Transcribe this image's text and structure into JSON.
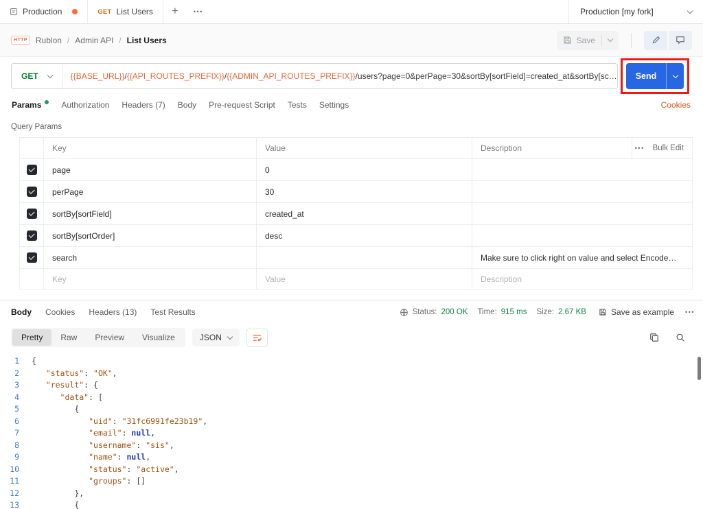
{
  "colors": {
    "brand_orange": "#ff6c37",
    "method_get_green": "#007f31",
    "send_button_blue": "#2767e3",
    "annotation_red": "#f21818",
    "status_green": "#0d8547",
    "variable_orange": "#e8683c",
    "link_orange": "#d9551e"
  },
  "topbar": {
    "collection_tab": {
      "label": "Production"
    },
    "request_tab": {
      "method": "GET",
      "label": "List Users"
    },
    "new_tab_button": "+",
    "more_tabs_button": "•••",
    "environment": {
      "name": "Production [my fork]"
    }
  },
  "breadcrumb": {
    "badge": "HTTP",
    "workspace": "Rublon",
    "separator": "/",
    "collection": "Admin API",
    "request_name": "List Users"
  },
  "header_actions": {
    "save_label": "Save"
  },
  "request": {
    "method": "GET",
    "url_parts": [
      {
        "type": "var",
        "text": "{{BASE_URL}}"
      },
      {
        "type": "plain",
        "text": "/"
      },
      {
        "type": "var",
        "text": "{{API_ROUTES_PREFIX}}"
      },
      {
        "type": "plain",
        "text": "/"
      },
      {
        "type": "var",
        "text": "{{ADMIN_API_ROUTES_PREFIX}}"
      },
      {
        "type": "plain",
        "text": "/users?page=0&perPage=30&sortBy[sortField]=created_at&sortBy[sc…"
      }
    ],
    "send_label": "Send",
    "tabs": [
      {
        "label": "Params",
        "active": true,
        "dot": true
      },
      {
        "label": "Authorization"
      },
      {
        "label": "Headers (7)"
      },
      {
        "label": "Body"
      },
      {
        "label": "Pre-request Script"
      },
      {
        "label": "Tests"
      },
      {
        "label": "Settings"
      }
    ],
    "cookies_link": "Cookies"
  },
  "params": {
    "section_title": "Query Params",
    "headers": {
      "key": "Key",
      "value": "Value",
      "description": "Description",
      "more": "•••",
      "bulk": "Bulk Edit"
    },
    "rows": [
      {
        "key": "page",
        "value": "0",
        "description": "",
        "checked": true
      },
      {
        "key": "perPage",
        "value": "30",
        "description": "",
        "checked": true
      },
      {
        "key": "sortBy[sortField]",
        "value": "created_at",
        "description": "",
        "checked": true
      },
      {
        "key": "sortBy[sortOrder]",
        "value": "desc",
        "description": "",
        "checked": true
      },
      {
        "key": "search",
        "value": "",
        "description": "Make sure to click right on value and select Encode…",
        "checked": true
      }
    ],
    "placeholder_row": {
      "key": "Key",
      "value": "Value",
      "description": "Description"
    }
  },
  "response": {
    "tabs": [
      {
        "label": "Body",
        "active": true
      },
      {
        "label": "Cookies"
      },
      {
        "label": "Headers (13)"
      },
      {
        "label": "Test Results"
      }
    ],
    "meta": {
      "status_label": "Status:",
      "status_value": "200 OK",
      "time_label": "Time:",
      "time_value": "915 ms",
      "size_label": "Size:",
      "size_value": "2.67 KB",
      "save_example": "Save as example",
      "more": "•••"
    },
    "view_modes": [
      {
        "label": "Pretty",
        "active": true
      },
      {
        "label": "Raw"
      },
      {
        "label": "Preview"
      },
      {
        "label": "Visualize"
      }
    ],
    "format": "JSON",
    "code": {
      "lines": [
        {
          "n": 1,
          "tokens": [
            [
              "p",
              "{"
            ]
          ]
        },
        {
          "n": 2,
          "tokens": [
            [
              "w",
              "   "
            ],
            [
              "k",
              "\"status\""
            ],
            [
              "p",
              ": "
            ],
            [
              "s",
              "\"OK\""
            ],
            [
              "p",
              ","
            ]
          ]
        },
        {
          "n": 3,
          "tokens": [
            [
              "w",
              "   "
            ],
            [
              "k",
              "\"result\""
            ],
            [
              "p",
              ": {"
            ]
          ]
        },
        {
          "n": 4,
          "tokens": [
            [
              "w",
              "      "
            ],
            [
              "k",
              "\"data\""
            ],
            [
              "p",
              ": ["
            ]
          ]
        },
        {
          "n": 5,
          "tokens": [
            [
              "w",
              "         "
            ],
            [
              "p",
              "{"
            ]
          ]
        },
        {
          "n": 6,
          "tokens": [
            [
              "w",
              "            "
            ],
            [
              "k",
              "\"uid\""
            ],
            [
              "p",
              ": "
            ],
            [
              "s",
              "\"31fc6991fe23b19\""
            ],
            [
              "p",
              ","
            ]
          ]
        },
        {
          "n": 7,
          "tokens": [
            [
              "w",
              "            "
            ],
            [
              "k",
              "\"email\""
            ],
            [
              "p",
              ": "
            ],
            [
              "n",
              "null"
            ],
            [
              "p",
              ","
            ]
          ]
        },
        {
          "n": 8,
          "tokens": [
            [
              "w",
              "            "
            ],
            [
              "k",
              "\"username\""
            ],
            [
              "p",
              ": "
            ],
            [
              "s",
              "\"sis\""
            ],
            [
              "p",
              ","
            ]
          ]
        },
        {
          "n": 9,
          "tokens": [
            [
              "w",
              "            "
            ],
            [
              "k",
              "\"name\""
            ],
            [
              "p",
              ": "
            ],
            [
              "n",
              "null"
            ],
            [
              "p",
              ","
            ]
          ]
        },
        {
          "n": 10,
          "tokens": [
            [
              "w",
              "            "
            ],
            [
              "k",
              "\"status\""
            ],
            [
              "p",
              ": "
            ],
            [
              "s",
              "\"active\""
            ],
            [
              "p",
              ","
            ]
          ]
        },
        {
          "n": 11,
          "tokens": [
            [
              "w",
              "            "
            ],
            [
              "k",
              "\"groups\""
            ],
            [
              "p",
              ": []"
            ]
          ]
        },
        {
          "n": 12,
          "tokens": [
            [
              "w",
              "         "
            ],
            [
              "p",
              "},"
            ]
          ]
        },
        {
          "n": 13,
          "tokens": [
            [
              "w",
              "         "
            ],
            [
              "p",
              "{"
            ]
          ]
        }
      ]
    }
  }
}
